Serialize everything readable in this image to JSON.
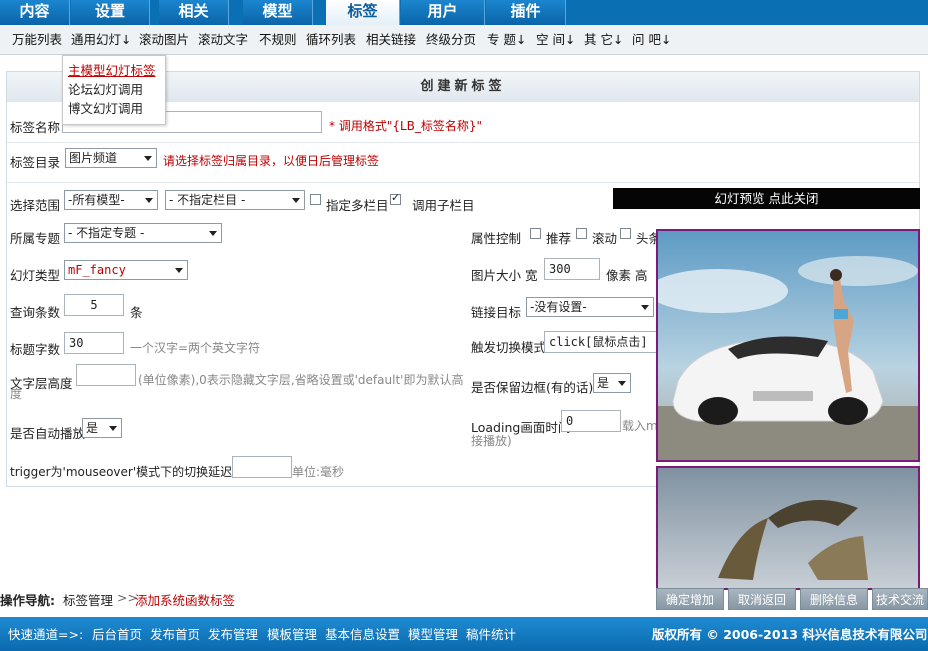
{
  "topnav": {
    "tabs": [
      "内容",
      "设置",
      "相关",
      "模型",
      "标签",
      "用户",
      "插件"
    ],
    "active": "标签"
  },
  "subnav": {
    "items": [
      "万能列表",
      "通用幻灯↓",
      "滚动图片",
      "滚动文字",
      "不规则",
      "循环列表",
      "相关链接",
      "终级分页",
      "专 题↓",
      "空 间↓",
      "其 它↓",
      "问 吧↓"
    ]
  },
  "dropdown": {
    "items": [
      "主模型幻灯标签",
      "论坛幻灯调用",
      "博文幻灯调用"
    ]
  },
  "form": {
    "title": "创建新标签",
    "tag_name": {
      "label": "标签名称",
      "value": "",
      "hint": "* 调用格式\"{LB_标签名称}\""
    },
    "tag_dir": {
      "label": "标签目录",
      "value": "图片频道",
      "hint": "请选择标签归属目录，以便日后管理标签"
    },
    "scope": {
      "label": "选择范围",
      "model": "-所有模型-",
      "column": "- 不指定栏目 -",
      "multi_label": "指定多栏目",
      "sub_label": "调用子栏目"
    },
    "topic": {
      "label": "所属专题",
      "value": "- 不指定专题 -"
    },
    "slide_type": {
      "label": "幻灯类型",
      "value": "mF_fancy"
    },
    "count": {
      "label": "查询条数",
      "value": "5",
      "unit": "条"
    },
    "title_len": {
      "label": "标题字数",
      "value": "30",
      "hint": "一个汉字=两个英文字符"
    },
    "text_height": {
      "label": "文字层高度",
      "value": "",
      "hint": "(单位像素),0表示隐藏文字层,省略设置或'default'即为默认高度"
    },
    "autoplay": {
      "label": "是否自动播放",
      "value": "是"
    },
    "trigger_delay": {
      "label": "trigger为'mouseover'模式下的切换延迟",
      "value": "",
      "unit": "单位:毫秒"
    },
    "attr": {
      "label": "属性控制",
      "opt1": "推荐",
      "opt2": "滚动",
      "opt3": "头条"
    },
    "img_size": {
      "label": "图片大小 宽",
      "width": "300",
      "unit_mid": "像素 高"
    },
    "link_target": {
      "label": "链接目标",
      "value": "-没有设置-"
    },
    "trigger_mode": {
      "label": "触发切换模式",
      "value": "click[鼠标点击]"
    },
    "border": {
      "label": "是否保留边框(有的话)",
      "value": "是"
    },
    "loading": {
      "label": "Loading画面时间",
      "value": "0",
      "hint1": "载入my",
      "hint2": "接播放)"
    },
    "preview_bar": "幻灯预览 点此关闭"
  },
  "ops": {
    "label": "操作导航:",
    "crumb": "标签管理",
    "sep": ">>",
    "action": "添加系统函数标签"
  },
  "buttons": [
    "确定增加",
    "取消返回",
    "删除信息",
    "技术交流"
  ],
  "footer": {
    "label": "快速通道=>:",
    "links": [
      "后台首页",
      "发布首页",
      "发布管理",
      "模板管理",
      "基本信息设置",
      "模型管理",
      "稿件统计"
    ],
    "copyright": "版权所有 © 2006-2013 科兴信息技术有限公司"
  },
  "colors": {
    "nav_blue": "#0b6fb4",
    "hint_red": "#c00000",
    "photo_border": "#7a1a7a"
  }
}
